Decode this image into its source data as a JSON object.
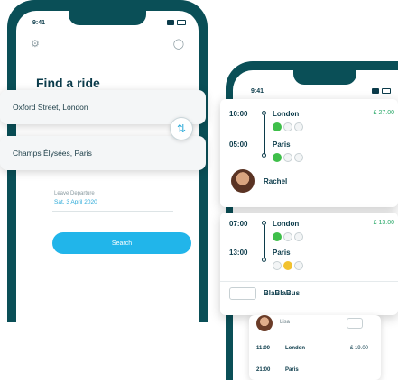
{
  "status": {
    "time": "9:41"
  },
  "search": {
    "title": "Find a ride",
    "from": "Oxford Street, London",
    "to": "Champs Élysées, Paris",
    "date_label": "Leave Departure",
    "date_value": "Sat, 3 April 2020",
    "button": "Search"
  },
  "results": [
    {
      "dep_time": "10:00",
      "dep_city": "London",
      "arr_time": "05:00",
      "arr_city": "Paris",
      "price": "£ 27.00",
      "driver": "Rachel"
    },
    {
      "dep_time": "07:00",
      "dep_city": "London",
      "arr_time": "13:00",
      "arr_city": "Paris",
      "price": "£ 13.00",
      "driver": "BlaBlaBus"
    }
  ],
  "mini": {
    "driver": "Lisa",
    "dep_time": "11:00",
    "dep_city": "London",
    "arr_time": "21:00",
    "arr_city": "Paris",
    "price": "£ 19.00"
  },
  "colors": {
    "frame": "#0a4f57",
    "accent": "#21b5ea",
    "seat_green": "#3fbf4a",
    "seat_yellow": "#f2c230"
  },
  "icons": {
    "settings": "gear-icon",
    "chat": "chat-icon",
    "swap": "swap-arrows-icon"
  }
}
